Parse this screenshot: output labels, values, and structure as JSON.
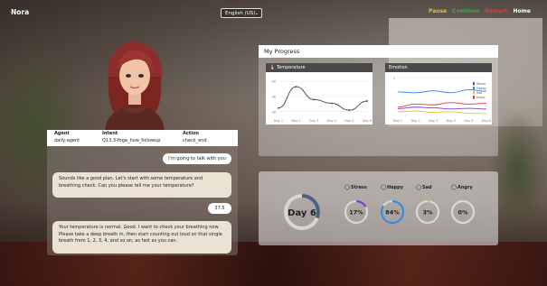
{
  "app": {
    "brand": "Nora"
  },
  "language": {
    "selected": "English (US)"
  },
  "nav": {
    "items": [
      {
        "label": "Pause",
        "color": "#e8c11c"
      },
      {
        "label": "Continue",
        "color": "#2bb34a"
      },
      {
        "label": "Restart",
        "color": "#e23a3a"
      },
      {
        "label": "Home",
        "color": "#ffffff"
      }
    ]
  },
  "agent_table": {
    "headers": [
      "Agent",
      "Intent",
      "Action"
    ],
    "row": [
      "daily-agent",
      "Q13.3-Yoga_how_followup",
      "check_end"
    ]
  },
  "chat": {
    "messages": [
      {
        "from": "user",
        "text": "I'm going to talk with you"
      },
      {
        "from": "bot",
        "text": "Sounds like a good plan. Let's start with some temperature and breathing check. Can you please tell me your temperature?"
      },
      {
        "from": "user",
        "text": "37.5"
      },
      {
        "from": "bot",
        "text": "Your temperature is normal. Good. I want to check your breathing now. Please take a deep breath in, then start counting out loud on that single breath from 1, 2, 3, 4, and so on, as fast as you can."
      }
    ]
  },
  "progress": {
    "title": "My Progress"
  },
  "chart_data": [
    {
      "type": "line",
      "title": "Temperature",
      "x": [
        "Day 1",
        "Day 2",
        "Day 3",
        "Day 4",
        "Day 5",
        "Day 6"
      ],
      "yticks": [
        40,
        38,
        36
      ],
      "ylim": [
        35.5,
        40.5
      ],
      "series": [
        {
          "values": [
            36.5,
            39.3,
            37.6,
            37.1,
            36.2,
            37.4
          ],
          "color": "#555555"
        }
      ]
    },
    {
      "type": "line",
      "title": "Emotion",
      "x": [
        "Day 1",
        "Day 2",
        "Day 3",
        "Day 4",
        "Day 5",
        "Day 6"
      ],
      "yticks": [
        1
      ],
      "ylim": [
        0,
        1
      ],
      "series": [
        {
          "name": "Stress",
          "color": "#7b3fc4",
          "values": [
            0.18,
            0.22,
            0.2,
            0.17,
            0.19,
            0.17
          ]
        },
        {
          "name": "Happy",
          "color": "#3a86e0",
          "values": [
            0.62,
            0.6,
            0.65,
            0.6,
            0.68,
            0.64
          ]
        },
        {
          "name": "Sad",
          "color": "#e8c11c",
          "values": [
            0.1,
            0.12,
            0.08,
            0.1,
            0.06,
            0.05
          ]
        },
        {
          "name": "Angry",
          "color": "#e23a3a",
          "values": [
            0.22,
            0.3,
            0.28,
            0.34,
            0.3,
            0.32
          ]
        }
      ]
    }
  ],
  "emotion_summary": {
    "day_label": "Day 6",
    "day_color": "#4a5f8a",
    "items": [
      {
        "name": "Stress",
        "value": "17%",
        "fraction": 0.17,
        "color": "#7b3fc4",
        "icon": "face-icon"
      },
      {
        "name": "Happy",
        "value": "84%",
        "fraction": 0.84,
        "color": "#3a86e0",
        "icon": "face-icon"
      },
      {
        "name": "Sad",
        "value": "3%",
        "fraction": 0.03,
        "color": "#e8c11c",
        "icon": "face-icon"
      },
      {
        "name": "Angry",
        "value": "0%",
        "fraction": 0.0,
        "color": "#e23a3a",
        "icon": "face-icon"
      }
    ]
  }
}
